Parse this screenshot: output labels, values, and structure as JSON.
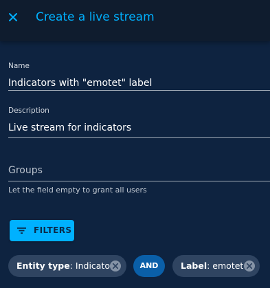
{
  "header": {
    "title": "Create a live stream",
    "close_icon": "close-icon"
  },
  "form": {
    "name": {
      "label": "Name",
      "value": "Indicators with \"emotet\" label"
    },
    "description": {
      "label": "Description",
      "value": "Live stream for indicators"
    },
    "groups": {
      "placeholder": "Groups",
      "helper": "Let the field empty to grant all users"
    }
  },
  "filters_button": {
    "label": "FILTERS",
    "icon": "filter-list-icon"
  },
  "filters": [
    {
      "key": "Entity type",
      "value": ": Indicator"
    },
    {
      "key": "Label",
      "value": ": emotet"
    }
  ],
  "operator": "AND",
  "colors": {
    "accent": "#00b1ff",
    "background": "#0e2340",
    "header": "#0f1c2e",
    "chip": "#2f4461",
    "operator_badge": "#0a5fa8"
  }
}
